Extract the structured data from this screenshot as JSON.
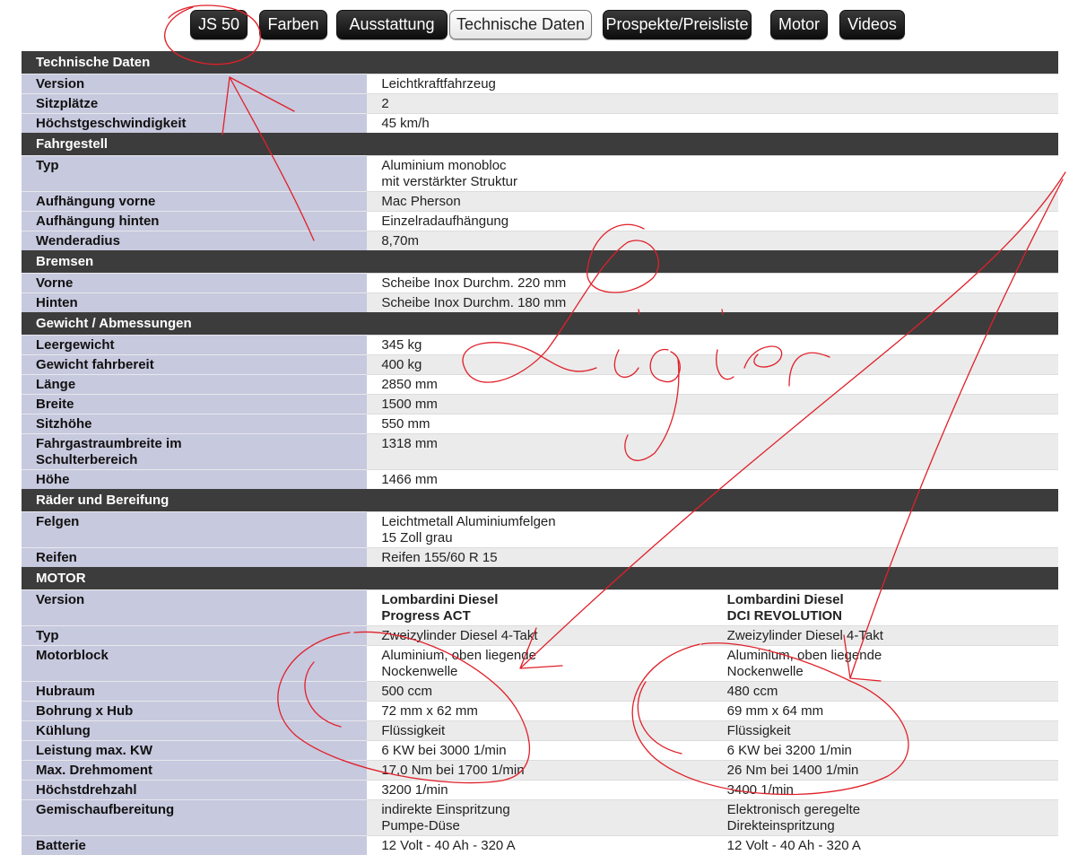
{
  "nav": [
    {
      "label": "JS 50",
      "active": false
    },
    {
      "label": "Farben",
      "active": false
    },
    {
      "label": "Ausstattung",
      "active": false
    },
    {
      "label": "Technische Daten",
      "active": true
    },
    {
      "label": "Prospekte/Preisliste",
      "active": false
    },
    {
      "label": "Motor",
      "active": false
    },
    {
      "label": "Videos",
      "active": false
    }
  ],
  "sections": [
    {
      "title": "Technische Daten",
      "rows": [
        {
          "label": "Version",
          "values": [
            "Leichtkraftfahrzeug"
          ]
        },
        {
          "label": "Sitzplätze",
          "values": [
            "2"
          ]
        },
        {
          "label": "Höchstgeschwindigkeit",
          "values": [
            "45 km/h"
          ]
        }
      ]
    },
    {
      "title": "Fahrgestell",
      "rows": [
        {
          "label": "Typ",
          "values": [
            "Aluminium monobloc\nmit verstärkter Struktur"
          ]
        },
        {
          "label": "Aufhängung vorne",
          "values": [
            "Mac Pherson"
          ]
        },
        {
          "label": "Aufhängung hinten",
          "values": [
            "Einzelradaufhängung"
          ]
        },
        {
          "label": "Wenderadius",
          "values": [
            "8,70m"
          ]
        }
      ]
    },
    {
      "title": "Bremsen",
      "rows": [
        {
          "label": "Vorne",
          "values": [
            "Scheibe Inox Durchm. 220 mm"
          ]
        },
        {
          "label": "Hinten",
          "values": [
            "Scheibe Inox Durchm. 180 mm"
          ]
        }
      ]
    },
    {
      "title": "Gewicht / Abmessungen",
      "rows": [
        {
          "label": "Leergewicht",
          "values": [
            "345 kg"
          ]
        },
        {
          "label": "Gewicht fahrbereit",
          "values": [
            "400 kg"
          ]
        },
        {
          "label": "Länge",
          "values": [
            "2850 mm"
          ]
        },
        {
          "label": "Breite",
          "values": [
            "1500 mm"
          ]
        },
        {
          "label": "Sitzhöhe",
          "values": [
            "550 mm"
          ]
        },
        {
          "label": "Fahrgastraumbreite im\nSchulterbereich",
          "values": [
            "1318 mm"
          ]
        },
        {
          "label": "Höhe",
          "values": [
            "1466 mm"
          ]
        }
      ]
    },
    {
      "title": "Räder und Bereifung",
      "rows": [
        {
          "label": "Felgen",
          "values": [
            "Leichtmetall Aluminiumfelgen\n15 Zoll grau"
          ]
        },
        {
          "label": "Reifen",
          "values": [
            "Reifen 155/60 R 15"
          ]
        }
      ]
    },
    {
      "title": "MOTOR",
      "rows": [
        {
          "label": "Version",
          "values": [
            "Lombardini Diesel\nProgress ACT",
            "Lombardini Diesel\nDCI REVOLUTION"
          ],
          "bold": true
        },
        {
          "label": "Typ",
          "values": [
            "Zweizylinder Diesel 4-Takt",
            "Zweizylinder Diesel 4-Takt"
          ]
        },
        {
          "label": "Motorblock",
          "values": [
            "Aluminium, oben liegende\nNockenwelle",
            "Aluminium, oben liegende\nNockenwelle"
          ]
        },
        {
          "label": "Hubraum",
          "values": [
            "500 ccm",
            "480 ccm"
          ]
        },
        {
          "label": "Bohrung x Hub",
          "values": [
            "72 mm x 62 mm",
            "69 mm x 64 mm"
          ]
        },
        {
          "label": "Kühlung",
          "values": [
            "Flüssigkeit",
            "Flüssigkeit"
          ]
        },
        {
          "label": "Leistung max. KW",
          "values": [
            "6 KW bei 3000 1/min",
            "6 KW bei 3200 1/min"
          ]
        },
        {
          "label": "Max. Drehmoment",
          "values": [
            "17,0 Nm bei 1700 1/min",
            "26 Nm bei 1400 1/min"
          ]
        },
        {
          "label": "Höchstdrehzahl",
          "values": [
            "3200 1/min",
            "3400 1/min"
          ]
        },
        {
          "label": "Gemischaufbereitung",
          "values": [
            "indirekte Einspritzung\nPumpe-Düse",
            "Elektronisch geregelte\nDirekteinspritzung"
          ]
        },
        {
          "label": "Batterie",
          "values": [
            "12 Volt - 40 Ah - 320 A",
            "12 Volt - 40 Ah - 320 A"
          ]
        }
      ]
    }
  ],
  "colors": {
    "section_bg": "#3c3c3c",
    "label_bg": "#c7c9de",
    "alt_row_bg": "#ebebeb",
    "annotation": "#e0202a"
  },
  "annotation": {
    "handwriting": "Ligier"
  }
}
